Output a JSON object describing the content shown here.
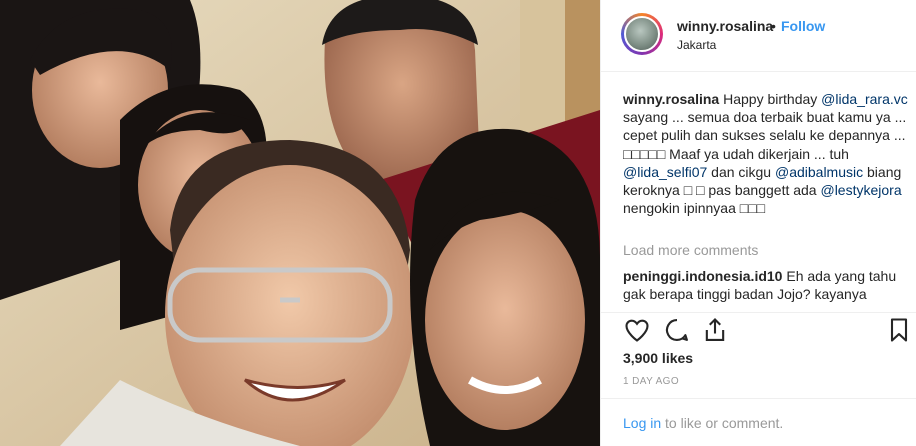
{
  "post": {
    "username": "winny.rosalina",
    "separator": "•",
    "follow_label": "Follow",
    "location": "Jakarta"
  },
  "caption": {
    "username": "winny.rosalina",
    "text_1": " Happy birthday ",
    "mention_1": "@lida_rara.vc",
    "text_2": " sayang ... semua doa terbaik buat kamu ya ... cepet pulih dan sukses selalu ke depannya ... □□□□□ Maaf ya udah dikerjain ... tuh ",
    "mention_2": "@lida_selfi07",
    "text_3": " dan cikgu ",
    "mention_3": "@adibalmusic",
    "text_4": " biang keroknya □ □ pas banggett ada ",
    "mention_4": "@lestykejora",
    "text_5": " nengokin ipinnyaa □□□"
  },
  "load_more_label": "Load more comments",
  "comment": {
    "username": "peninggi.indonesia.id10",
    "text": " Eh ada yang tahu gak berapa tinggi badan Jojo? kayanya"
  },
  "icons": {
    "like": "heart-icon",
    "comment": "comment-icon",
    "share": "share-icon",
    "save": "bookmark-icon"
  },
  "likes_label": "3,900 likes",
  "time_label": "1 DAY AGO",
  "footer": {
    "login_link": "Log in",
    "login_rest": " to like or comment."
  },
  "colors": {
    "accent": "#3897f0",
    "mention": "#003569",
    "muted": "#999999",
    "text": "#262626",
    "border": "#efefef"
  }
}
